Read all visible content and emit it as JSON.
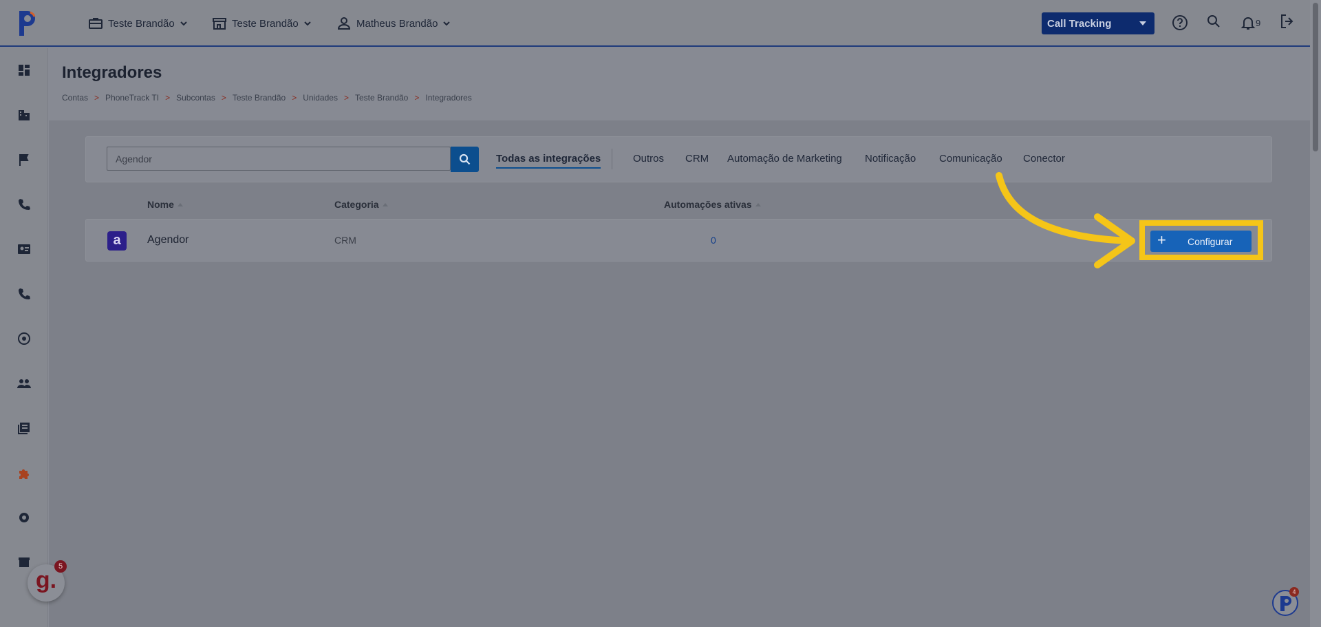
{
  "topbar": {
    "account_label": "Teste Brandão",
    "unit_label": "Teste Brandão",
    "user_label": "Matheus Brandão",
    "product_select": "Call Tracking",
    "notification_count": "9"
  },
  "page": {
    "title": "Integradores",
    "breadcrumb": [
      "Contas",
      "PhoneTrack TI",
      "Subcontas",
      "Teste Brandão",
      "Unidades",
      "Teste Brandão",
      "Integradores"
    ],
    "breadcrumb_separator": ">"
  },
  "search": {
    "value": "Agendor",
    "placeholder": ""
  },
  "tabs": [
    "Todas as integrações",
    "Outros",
    "CRM",
    "Automação de Marketing",
    "Notificação",
    "Comunicação",
    "Conector"
  ],
  "table": {
    "headers": [
      "Nome",
      "Categoria",
      "Automações ativas"
    ],
    "rows": [
      {
        "logo_letter": "a",
        "name": "Agendor",
        "category": "CRM",
        "active_automations": "0",
        "action_label": "Configurar"
      }
    ]
  },
  "widgets": {
    "g_badge": "5",
    "p_badge": "4",
    "g_letter": "g."
  },
  "colors": {
    "accent": "#1763b8",
    "highlight": "#f5c518",
    "brand_dark": "#0d2b6e"
  }
}
